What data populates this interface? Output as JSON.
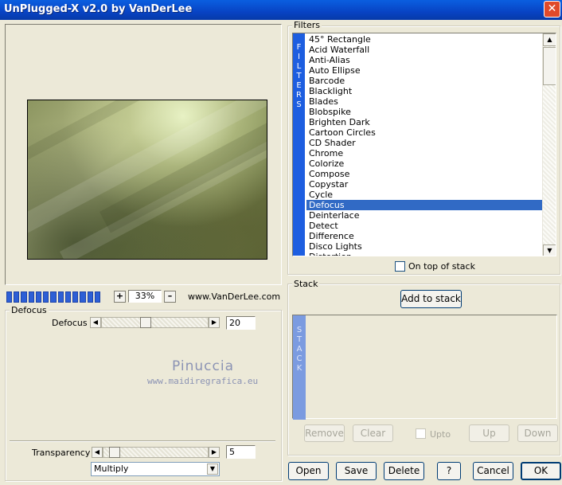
{
  "window": {
    "title": "UnPlugged-X v2.0 by VanDerLee",
    "close_glyph": "✕"
  },
  "toolbar": {
    "zoom_in": "+",
    "zoom_value": "33%",
    "zoom_out": "–",
    "website": "www.VanDerLee.com",
    "progress_fraction": 1.0
  },
  "params": {
    "group_title": "Defocus",
    "defocus_label": "Defocus",
    "defocus_value": "20",
    "defocus_fraction": 0.35,
    "transparency_label": "Transparency",
    "transparency_value": "5",
    "transparency_fraction": 0.05,
    "blend_mode": "Multiply"
  },
  "watermark": {
    "name": "Pinuccia",
    "site": "www.maidiregrafica.eu"
  },
  "filters": {
    "group_title": "Filters",
    "tab_letters": [
      "F",
      "I",
      "L",
      "T",
      "E",
      "R",
      "S"
    ],
    "items": [
      "45° Rectangle",
      "Acid Waterfall",
      "Anti-Alias",
      "Auto Ellipse",
      "Barcode",
      "Blacklight",
      "Blades",
      "Blobspike",
      "Brighten Dark",
      "Cartoon Circles",
      "CD Shader",
      "Chrome",
      "Colorize",
      "Compose",
      "Copystar",
      "Cycle",
      "Defocus",
      "Deinterlace",
      "Detect",
      "Difference",
      "Disco Lights",
      "Distortion"
    ],
    "selected": "Defocus",
    "on_top_label": "On top of stack"
  },
  "stack": {
    "group_title": "Stack",
    "add_label": "Add to stack",
    "tab_letters": [
      "S",
      "T",
      "A",
      "C",
      "K"
    ],
    "remove_label": "Remove",
    "clear_label": "Clear",
    "upto_label": "Upto",
    "up_label": "Up",
    "down_label": "Down"
  },
  "buttons": {
    "open": "Open",
    "save": "Save",
    "delete": "Delete",
    "help": "?",
    "cancel": "Cancel",
    "ok": "OK"
  },
  "colors": {
    "title_bar": "#0843c4",
    "selection": "#316ac5",
    "filters_tab": "#1d5ee0",
    "stack_tab": "#7b9be0",
    "watermark": "#8b93b4"
  }
}
